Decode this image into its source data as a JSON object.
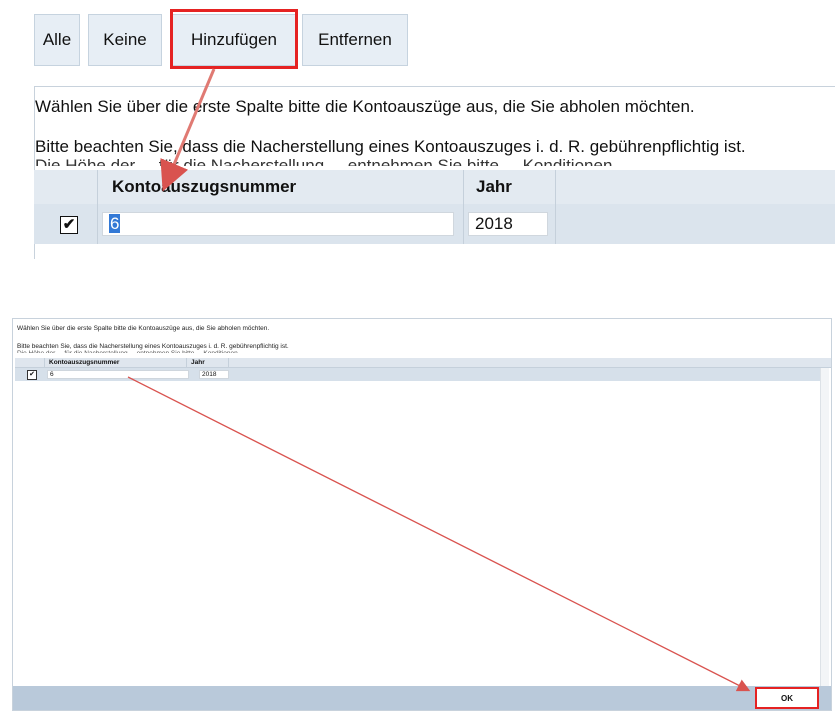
{
  "toolbar": {
    "all_label": "Alle",
    "none_label": "Keine",
    "add_label": "Hinzufügen",
    "remove_label": "Entfernen"
  },
  "info": {
    "line1": "Wählen Sie über die erste Spalte bitte die Kontoauszüge aus, die Sie abholen möchten.",
    "line2": "Bitte beachten Sie, dass die Nacherstellung eines Kontoauszuges i. d. R. gebührenpflichtig ist.",
    "line3_partial": "Die Höhe der ... für die Nacherstellung ... entnehmen Sie bitte ... Konditionen"
  },
  "table": {
    "columns": [
      "Kontoauszugsnummer",
      "Jahr"
    ],
    "rows": [
      {
        "selected": true,
        "number": "6",
        "year": "2018"
      }
    ]
  },
  "dialog": {
    "ok_label": "OK"
  },
  "colors": {
    "highlight": "#e52222",
    "header_bg": "#e3eaf1",
    "row_bg": "#dbe4ed",
    "footer_bg": "#b9c9da"
  }
}
